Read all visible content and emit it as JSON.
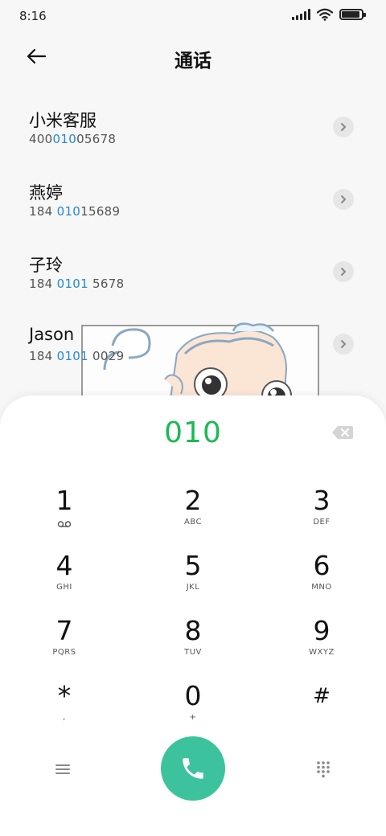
{
  "status_bar": {
    "time": "8:16",
    "icons": [
      "signal-icon",
      "wifi-icon",
      "battery-icon"
    ],
    "battery_level": 0.9
  },
  "header": {
    "title": "通话",
    "back_icon": "back-arrow-icon"
  },
  "contacts": [
    {
      "name": "小米客服",
      "number_parts": [
        "400",
        "010",
        "05678"
      ]
    },
    {
      "name": "燕婷",
      "number_parts": [
        "184 ",
        "010",
        "15689"
      ]
    },
    {
      "name": "子玲",
      "number_parts": [
        "184 ",
        "0101",
        " 5678"
      ]
    },
    {
      "name": "Jason",
      "number_parts": [
        "184 ",
        "0101",
        " 0029"
      ]
    }
  ],
  "dialer": {
    "input": "010",
    "backspace_icon": "backspace-icon",
    "keys": [
      {
        "digit": "1",
        "letters": "",
        "sub_icon": "voicemail-icon"
      },
      {
        "digit": "2",
        "letters": "ABC"
      },
      {
        "digit": "3",
        "letters": "DEF"
      },
      {
        "digit": "4",
        "letters": "GHI"
      },
      {
        "digit": "5",
        "letters": "JKL"
      },
      {
        "digit": "6",
        "letters": "MNO"
      },
      {
        "digit": "7",
        "letters": "PQRS"
      },
      {
        "digit": "8",
        "letters": "TUV"
      },
      {
        "digit": "9",
        "letters": "WXYZ"
      },
      {
        "digit": "*",
        "letters": ","
      },
      {
        "digit": "0",
        "letters": "+"
      },
      {
        "digit": "#",
        "letters": ""
      }
    ],
    "bottom_icons": [
      "menu-icon",
      "phone-icon",
      "keypad-icon"
    ]
  },
  "colors": {
    "match_highlight": "#2389d6",
    "dial_input": "#1db954",
    "call_button": "#3cc39e"
  }
}
